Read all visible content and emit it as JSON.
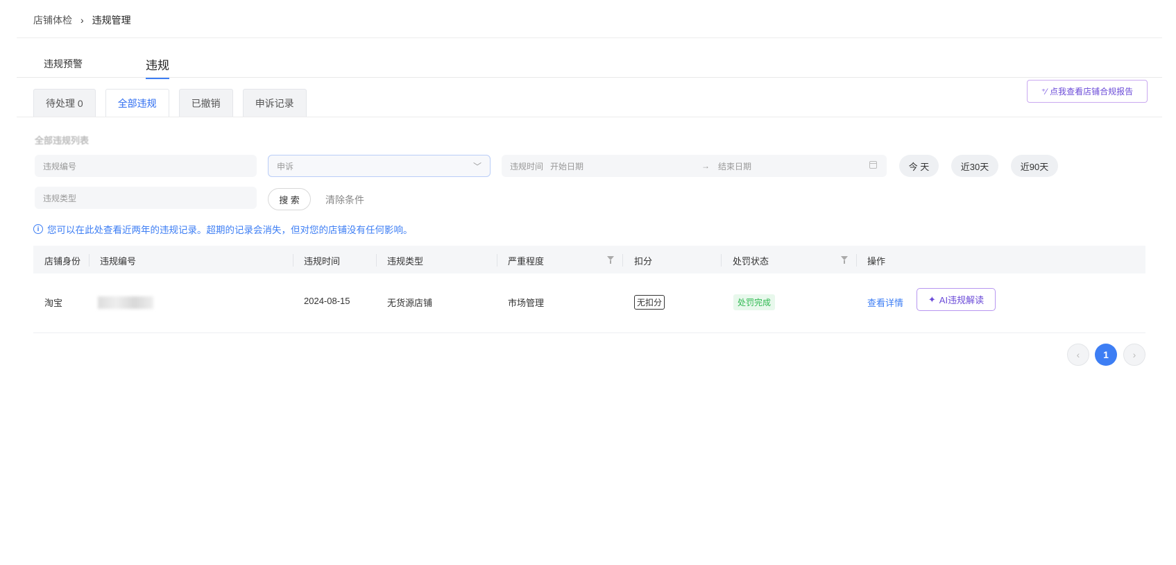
{
  "breadcrumb": {
    "parent": "店铺体检",
    "separator": "›",
    "current": "违规管理"
  },
  "main_tabs": [
    "违规预警",
    "违规"
  ],
  "sub_tabs": [
    "待处理 0",
    "全部违规",
    "已撤销",
    "申诉记录"
  ],
  "report_button": "点我查看店铺合规报告",
  "list_title": "全部违规列表",
  "filters": {
    "code_placeholder": "违规编号",
    "select_value": "申诉",
    "date_label": "违规时间",
    "start_placeholder": "开始日期",
    "arrow": "→",
    "end_placeholder": "结束日期",
    "type_placeholder": "违规类型",
    "quick": [
      "今 天",
      "近30天",
      "近90天"
    ],
    "search": "搜 索",
    "clear": "清除条件"
  },
  "notice": "您可以在此处查看近两年的违规记录。超期的记录会消失，但对您的店铺没有任何影响。",
  "table": {
    "headers": [
      "店铺身份",
      "违规编号",
      "违规时间",
      "违规类型",
      "严重程度",
      "扣分",
      "处罚状态",
      "操作"
    ],
    "rows": [
      {
        "identity": "淘宝",
        "time": "2024-08-15",
        "type": "无货源店铺",
        "severity": "市场管理",
        "deduction": "无扣分",
        "status": "处罚完成",
        "action_detail": "查看详情",
        "action_ai": "AI违规解读"
      }
    ]
  },
  "pagination": {
    "current": "1",
    "prev": "‹",
    "next": "›"
  },
  "colors": {
    "primary": "#3d7ef4",
    "ai_purple": "#6b4bd8",
    "success": "#2fb851"
  }
}
